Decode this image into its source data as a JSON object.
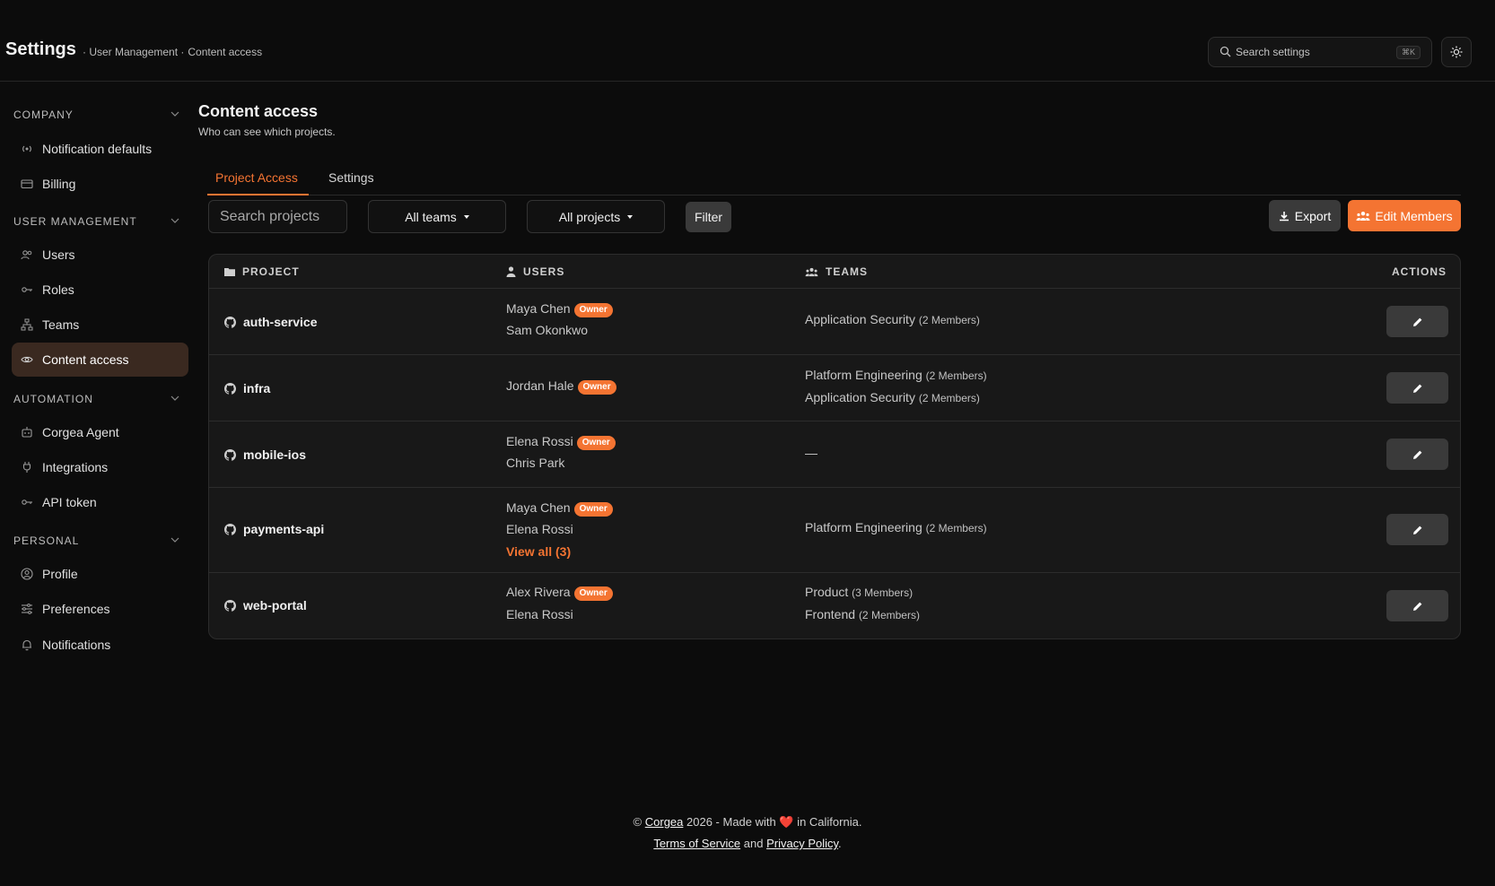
{
  "header": {
    "title": "Settings",
    "breadcrumb": [
      "· User Management ·",
      "Content access"
    ],
    "search_placeholder": "Search settings",
    "search_shortcut": "⌘K",
    "theme_icon": "sun-icon"
  },
  "sidebar": {
    "sections": [
      {
        "label": "COMPANY",
        "items": [
          {
            "label": "Notification defaults",
            "icon": "broadcast-icon"
          },
          {
            "label": "Billing",
            "icon": "credit-card-icon"
          }
        ]
      },
      {
        "label": "USER MANAGEMENT",
        "items": [
          {
            "label": "Users",
            "icon": "users-icon"
          },
          {
            "label": "Roles",
            "icon": "key-icon"
          },
          {
            "label": "Teams",
            "icon": "org-chart-icon"
          },
          {
            "label": "Content access",
            "icon": "eye-icon",
            "active": true
          }
        ]
      },
      {
        "label": "AUTOMATION",
        "items": [
          {
            "label": "Corgea Agent",
            "icon": "robot-icon"
          },
          {
            "label": "Integrations",
            "icon": "plug-icon"
          },
          {
            "label": "API token",
            "icon": "key-icon"
          }
        ]
      },
      {
        "label": "PERSONAL",
        "items": [
          {
            "label": "Profile",
            "icon": "user-circle-icon"
          },
          {
            "label": "Preferences",
            "icon": "sliders-icon"
          },
          {
            "label": "Notifications",
            "icon": "bell-icon"
          }
        ]
      }
    ]
  },
  "main": {
    "title": "Content access",
    "subtitle": "Who can see which projects.",
    "tabs": [
      {
        "label": "Project Access",
        "active": true
      },
      {
        "label": "Settings",
        "active": false
      }
    ],
    "toolbar": {
      "search_placeholder": "Search projects",
      "teams_select": "All teams",
      "projects_select": "All projects",
      "filter_label": "Filter",
      "export_label": "Export",
      "edit_members_label": "Edit Members"
    },
    "table": {
      "columns": [
        "PROJECT",
        "USERS",
        "TEAMS",
        "ACTIONS"
      ],
      "owner_badge": "Owner",
      "rows": [
        {
          "project": "auth-service",
          "users": [
            {
              "name": "Maya Chen",
              "owner": true
            },
            {
              "name": "Sam Okonkwo",
              "owner": false
            }
          ],
          "teams": [
            {
              "name": "Application Security",
              "members": "(2 Members)"
            }
          ]
        },
        {
          "project": "infra",
          "users": [
            {
              "name": "Jordan Hale",
              "owner": true
            }
          ],
          "teams": [
            {
              "name": "Platform Engineering",
              "members": "(2 Members)"
            },
            {
              "name": "Application Security",
              "members": "(2 Members)"
            }
          ]
        },
        {
          "project": "mobile-ios",
          "users": [
            {
              "name": "Elena Rossi",
              "owner": true
            },
            {
              "name": "Chris Park",
              "owner": false
            }
          ],
          "teams_empty": "—"
        },
        {
          "project": "payments-api",
          "users": [
            {
              "name": "Maya Chen",
              "owner": true
            },
            {
              "name": "Elena Rossi",
              "owner": false
            }
          ],
          "view_all": "View all (3)",
          "teams": [
            {
              "name": "Platform Engineering",
              "members": "(2 Members)"
            }
          ]
        },
        {
          "project": "web-portal",
          "users": [
            {
              "name": "Alex Rivera",
              "owner": true
            },
            {
              "name": "Elena Rossi",
              "owner": false
            }
          ],
          "teams": [
            {
              "name": "Product",
              "members": "(3 Members)"
            },
            {
              "name": "Frontend",
              "members": "(2 Members)"
            }
          ]
        }
      ]
    }
  },
  "footer": {
    "copyright": "©",
    "brand_link": "Corgea",
    "made_with": "2026 - Made with",
    "heart": "❤️",
    "location": "in California.",
    "terms_link": "Terms of Service",
    "and": "and",
    "privacy_link": "Privacy Policy",
    "period": "."
  }
}
